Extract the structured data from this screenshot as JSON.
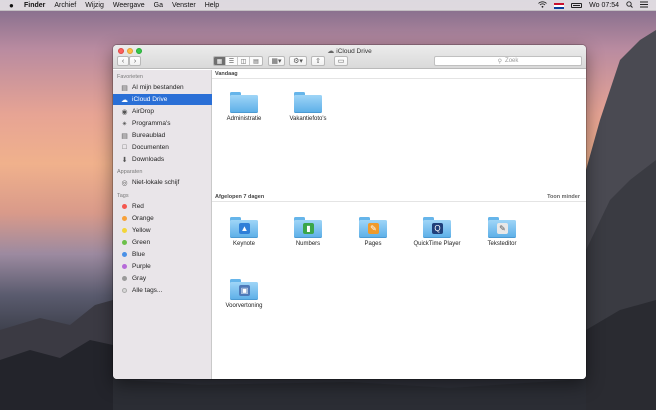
{
  "menubar": {
    "apple": "",
    "app": "Finder",
    "items": [
      "Archief",
      "Wijzig",
      "Weergave",
      "Ga",
      "Venster",
      "Help"
    ],
    "clock": "Wo 07:54"
  },
  "window": {
    "title": "iCloud Drive",
    "search_placeholder": "Zoek"
  },
  "sidebar": {
    "favorites_heading": "Favorieten",
    "favorites": [
      {
        "label": "Al mijn bestanden",
        "icon": "all-files-icon"
      },
      {
        "label": "iCloud Drive",
        "icon": "cloud-icon",
        "selected": true
      },
      {
        "label": "AirDrop",
        "icon": "airdrop-icon"
      },
      {
        "label": "Programma's",
        "icon": "applications-icon"
      },
      {
        "label": "Bureaublad",
        "icon": "desktop-icon"
      },
      {
        "label": "Documenten",
        "icon": "documents-icon"
      },
      {
        "label": "Downloads",
        "icon": "downloads-icon"
      }
    ],
    "devices_heading": "Apparaten",
    "devices": [
      {
        "label": "Niet-lokale schijf",
        "icon": "disk-icon"
      }
    ],
    "tags_heading": "Tags",
    "tags": [
      {
        "label": "Red",
        "color": "#f4574f"
      },
      {
        "label": "Orange",
        "color": "#f7a13a"
      },
      {
        "label": "Yellow",
        "color": "#f3d53a"
      },
      {
        "label": "Green",
        "color": "#6cc04a"
      },
      {
        "label": "Blue",
        "color": "#4a90e6"
      },
      {
        "label": "Purple",
        "color": "#b66ad9"
      },
      {
        "label": "Gray",
        "color": "#9a9a9a"
      }
    ],
    "all_tags": "Alle tags..."
  },
  "content": {
    "today_heading": "Vandaag",
    "today_items": [
      "Administratie",
      "Vakantiefoto's"
    ],
    "week_heading": "Afgelopen 7 dagen",
    "week_action": "Toon minder",
    "week_items": [
      {
        "label": "Keynote",
        "icon": "keynote-icon",
        "color": "#2f7fd8"
      },
      {
        "label": "Numbers",
        "icon": "numbers-icon",
        "color": "#3aa64a"
      },
      {
        "label": "Pages",
        "icon": "pages-icon",
        "color": "#f09a2a"
      },
      {
        "label": "QuickTime Player",
        "icon": "quicktime-icon",
        "color": "#1f3f7a"
      },
      {
        "label": "Teksteditor",
        "icon": "textedit-icon",
        "color": "#e8e8e8"
      },
      {
        "label": "Voorvertoning",
        "icon": "preview-icon",
        "color": "#4e79b8"
      }
    ]
  }
}
